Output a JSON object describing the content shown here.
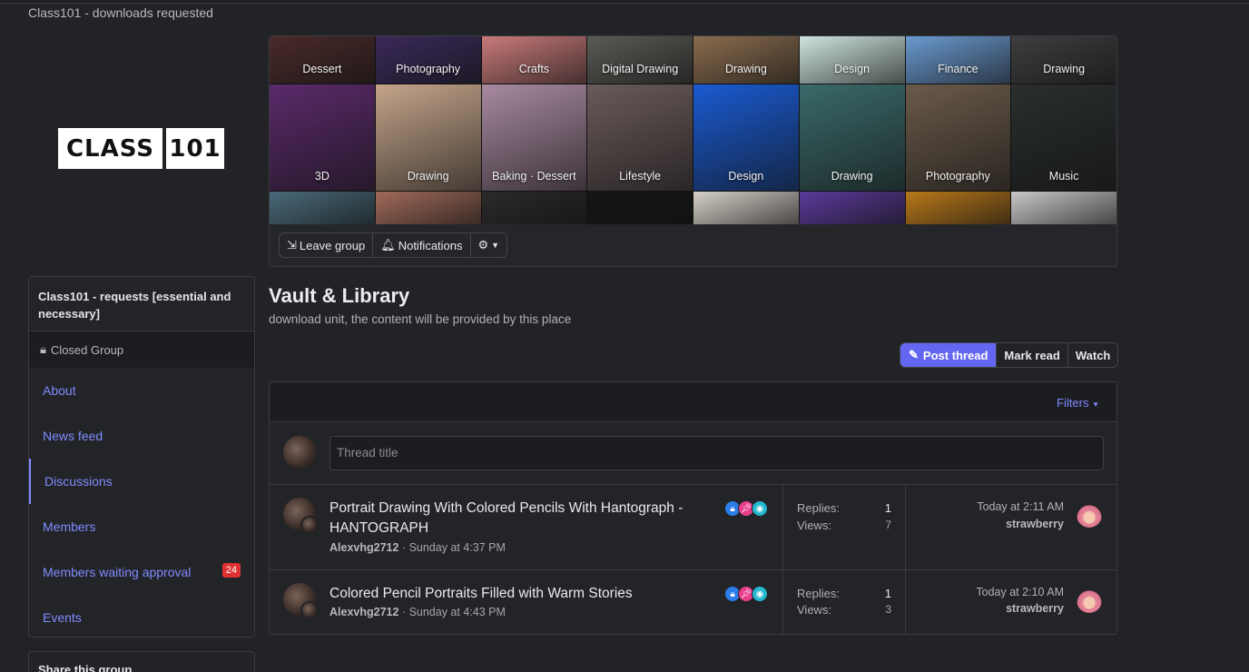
{
  "breadcrumb": "Class101 - downloads requested",
  "logo": {
    "part1": "CLASS",
    "part2": "101"
  },
  "banner": {
    "row1": [
      {
        "label": "Dessert",
        "color": "#4a2a2a"
      },
      {
        "label": "Photography",
        "color": "#3a2a5a"
      },
      {
        "label": "Crafts",
        "color": "#c97a7a"
      },
      {
        "label": "Digital Drawing",
        "color": "#5a5a56"
      },
      {
        "label": "Drawing",
        "color": "#8a6c4e"
      },
      {
        "label": "Design",
        "color": "#cfe5e0"
      },
      {
        "label": "Finance",
        "color": "#6a9ad0"
      },
      {
        "label": "Drawing",
        "color": "#3e3e3e"
      }
    ],
    "row2": [
      {
        "label": "3D",
        "color": "#5a2a6a"
      },
      {
        "label": "Drawing",
        "color": "#c4a48a"
      },
      {
        "label": "Baking · Dessert",
        "color": "#a88aa0"
      },
      {
        "label": "Lifestyle",
        "color": "#6a5a5a"
      },
      {
        "label": "Design",
        "color": "#1a5ad0"
      },
      {
        "label": "Drawing",
        "color": "#3a6a6a"
      },
      {
        "label": "Photography",
        "color": "#6a5a4a"
      },
      {
        "label": "Music",
        "color": "#2a2e2e"
      }
    ],
    "row3": [
      "#4a6a7a",
      "#a06a5a",
      "#2a2a2a",
      "#151515",
      "#d6d0c8",
      "#5a3a9a",
      "#b8781a",
      "#c8c8c8"
    ],
    "buttons": {
      "leave": "Leave group",
      "notifications": "Notifications"
    }
  },
  "sidebar": {
    "group_title": "Class101 - requests [essential and necessary]",
    "closed_label": "Closed Group",
    "items": [
      {
        "label": "About"
      },
      {
        "label": "News feed"
      },
      {
        "label": "Discussions"
      },
      {
        "label": "Members"
      },
      {
        "label": "Members waiting approval",
        "badge": "24"
      },
      {
        "label": "Events"
      }
    ],
    "share_title": "Share this group"
  },
  "page": {
    "title": "Vault & Library",
    "description": "download unit, the content will be provided by this place"
  },
  "toolbar": {
    "post": "Post thread",
    "mark_read": "Mark read",
    "watch": "Watch"
  },
  "list": {
    "filters": "Filters",
    "thread_placeholder": "Thread title",
    "threads": [
      {
        "title": "Portrait Drawing With Colored Pencils With Hantograph - HANTOGRAPH",
        "author": "Alexvhg2712",
        "date": "Sunday at 4:37 PM",
        "replies_label": "Replies:",
        "replies": "1",
        "views_label": "Views:",
        "views": "7",
        "last_time": "Today at 2:11 AM",
        "last_user": "strawberry"
      },
      {
        "title": "Colored Pencil Portraits Filled with Warm Stories",
        "author": "Alexvhg2712",
        "date": "Sunday at 4:43 PM",
        "replies_label": "Replies:",
        "replies": "1",
        "views_label": "Views:",
        "views": "3",
        "last_time": "Today at 2:10 AM",
        "last_user": "strawberry"
      }
    ]
  }
}
